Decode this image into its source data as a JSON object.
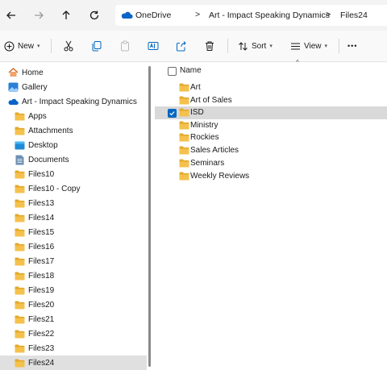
{
  "address": {
    "crumbs": [
      "OneDrive",
      "Art - Impact Speaking Dynamics",
      "Files24"
    ],
    "separator": ">"
  },
  "commands": {
    "new_label": "New",
    "sort_label": "Sort",
    "view_label": "View",
    "more_label": "•••"
  },
  "sidebar": {
    "items": [
      {
        "label": "Home",
        "icon": "home-icon"
      },
      {
        "label": "Gallery",
        "icon": "gallery-icon"
      },
      {
        "label": "Art - Impact Speaking Dynamics",
        "icon": "cloud-icon"
      },
      {
        "label": "Apps",
        "icon": "folder-icon"
      },
      {
        "label": "Attachments",
        "icon": "folder-icon"
      },
      {
        "label": "Desktop",
        "icon": "desktop-icon"
      },
      {
        "label": "Documents",
        "icon": "documents-icon"
      },
      {
        "label": "Files10",
        "icon": "folder-icon"
      },
      {
        "label": "Files10 - Copy",
        "icon": "folder-icon"
      },
      {
        "label": "Files13",
        "icon": "folder-icon"
      },
      {
        "label": "Files14",
        "icon": "folder-icon"
      },
      {
        "label": "Files15",
        "icon": "folder-icon"
      },
      {
        "label": "Files16",
        "icon": "folder-icon"
      },
      {
        "label": "Files17",
        "icon": "folder-icon"
      },
      {
        "label": "Files18",
        "icon": "folder-icon"
      },
      {
        "label": "Files19",
        "icon": "folder-icon"
      },
      {
        "label": "Files20",
        "icon": "folder-icon"
      },
      {
        "label": "Files21",
        "icon": "folder-icon"
      },
      {
        "label": "Files22",
        "icon": "folder-icon"
      },
      {
        "label": "Files23",
        "icon": "folder-icon"
      },
      {
        "label": "Files24",
        "icon": "folder-icon",
        "selected": true
      }
    ]
  },
  "content": {
    "column_name": "Name",
    "rows": [
      {
        "label": "Art"
      },
      {
        "label": "Art of Sales"
      },
      {
        "label": "ISD",
        "selected": true
      },
      {
        "label": "Ministry"
      },
      {
        "label": "Rockies"
      },
      {
        "label": "Sales Articles"
      },
      {
        "label": "Seminars"
      },
      {
        "label": "Weekly Reviews"
      }
    ]
  },
  "colors": {
    "accent": "#0067c0",
    "folder": "#f4c14d",
    "folder_dark": "#e2a92c",
    "selected_bg": "#e0e0e0"
  }
}
